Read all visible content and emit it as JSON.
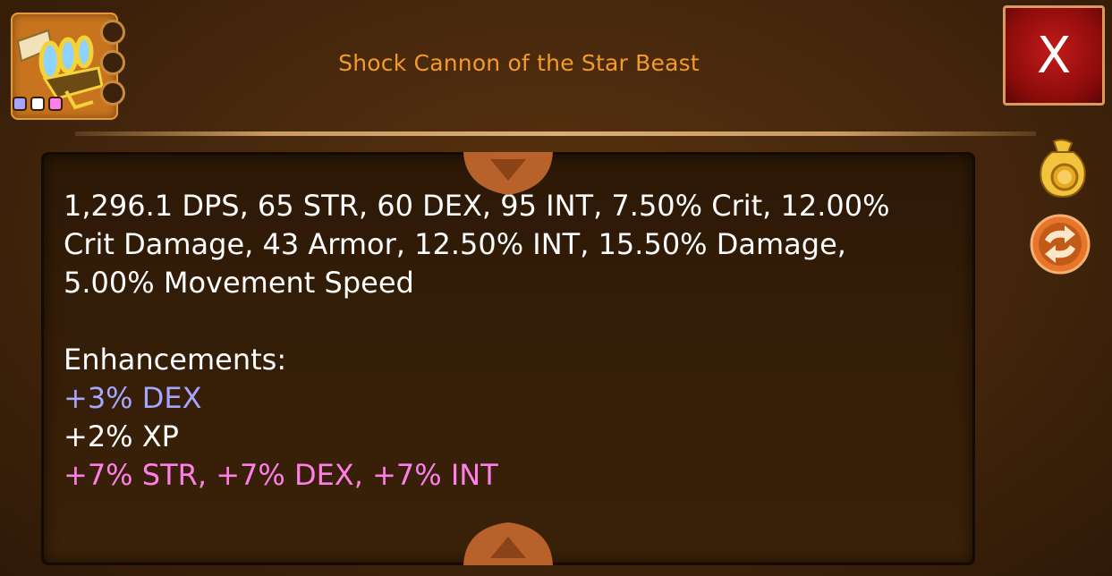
{
  "item": {
    "name": "Shock Cannon of the Star Beast",
    "gem_colors": [
      "#a6a6ff",
      "#ffffff",
      "#ff7fe8"
    ]
  },
  "close_button": {
    "label": "X"
  },
  "stats": {
    "lines": [
      "1,296.1 DPS, 65 STR, 60 DEX, 95 INT, 7.50% Crit, 12.00%",
      "Crit Damage, 43 Armor, 12.50% INT, 15.50% Damage,",
      "5.00% Movement Speed"
    ],
    "enhancements_label": "Enhancements:",
    "enhancements": [
      {
        "text": "+3% DEX",
        "color": "#a6a6ff"
      },
      {
        "text": "+2% XP",
        "color": "#ffffff"
      },
      {
        "text": "+7% STR, +7% DEX, +7% INT",
        "color": "#ff7fe8"
      }
    ]
  },
  "icons": {
    "sell": "coin-bag-icon",
    "swap": "swap-arrows-icon",
    "scroll_up": "scroll-up-icon",
    "scroll_down": "scroll-down-icon"
  },
  "colors": {
    "title": "#f39a2b",
    "background": "#44260c",
    "close_button": "#b01414"
  }
}
